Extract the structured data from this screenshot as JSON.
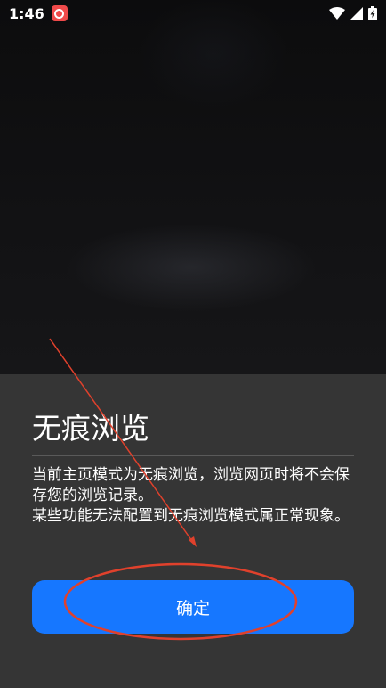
{
  "status_bar": {
    "time": "1:46",
    "notification_icon": "app-notification-icon",
    "wifi_icon": "wifi-icon",
    "signal_icon": "signal-icon",
    "battery_icon": "battery-charging-icon"
  },
  "dialog": {
    "title": "无痕浏览",
    "paragraphs": [
      "当前主页模式为无痕浏览，浏览网页时将不会保存您的浏览记录。",
      "某些功能无法配置到无痕浏览模式属正常现象。"
    ],
    "confirm_label": "确定"
  },
  "colors": {
    "sheet_background": "#353535",
    "button_accent": "#1677ff",
    "annotation_red": "#e0412c"
  }
}
